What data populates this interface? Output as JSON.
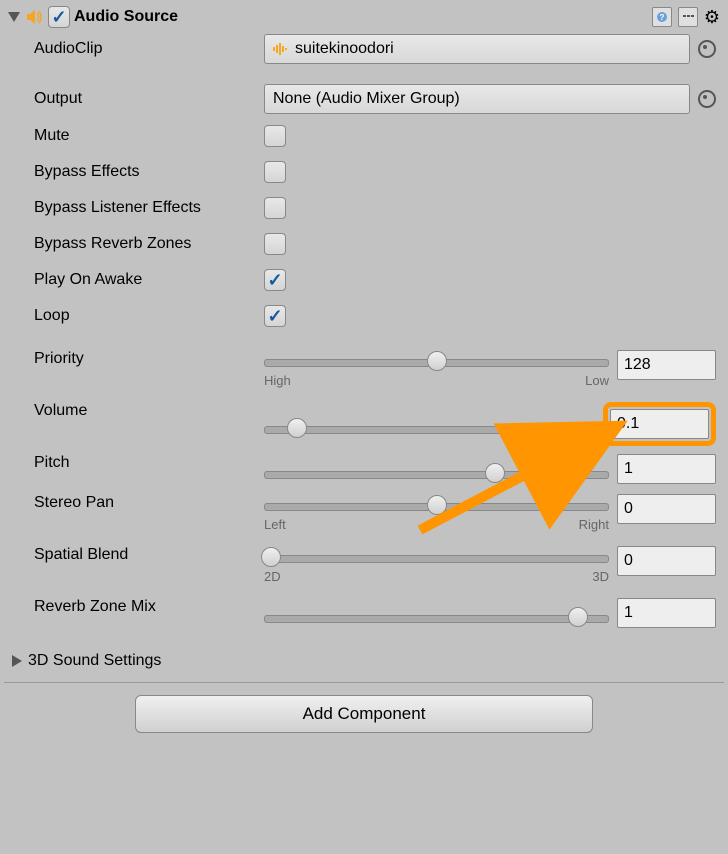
{
  "header": {
    "title": "Audio Source"
  },
  "fields": {
    "audioClip": {
      "label": "AudioClip",
      "value": "suitekinoodori"
    },
    "output": {
      "label": "Output",
      "value": "None (Audio Mixer Group)"
    },
    "mute": {
      "label": "Mute"
    },
    "bypassEffects": {
      "label": "Bypass Effects"
    },
    "bypassListener": {
      "label": "Bypass Listener Effects"
    },
    "bypassReverb": {
      "label": "Bypass Reverb Zones"
    },
    "playOnAwake": {
      "label": "Play On Awake"
    },
    "loop": {
      "label": "Loop"
    }
  },
  "sliders": {
    "priority": {
      "label": "Priority",
      "value": "128",
      "leftLabel": "High",
      "rightLabel": "Low",
      "pct": 50
    },
    "volume": {
      "label": "Volume",
      "value": "0.1",
      "pct": 10
    },
    "pitch": {
      "label": "Pitch",
      "value": "1",
      "pct": 67
    },
    "stereoPan": {
      "label": "Stereo Pan",
      "value": "0",
      "leftLabel": "Left",
      "rightLabel": "Right",
      "pct": 50
    },
    "spatialBlend": {
      "label": "Spatial Blend",
      "value": "0",
      "leftLabel": "2D",
      "rightLabel": "3D",
      "pct": 1
    },
    "reverbZoneMix": {
      "label": "Reverb Zone Mix",
      "value": "1",
      "pct": 91
    }
  },
  "section": {
    "soundSettings": "3D Sound Settings"
  },
  "buttons": {
    "addComponent": "Add Component"
  }
}
